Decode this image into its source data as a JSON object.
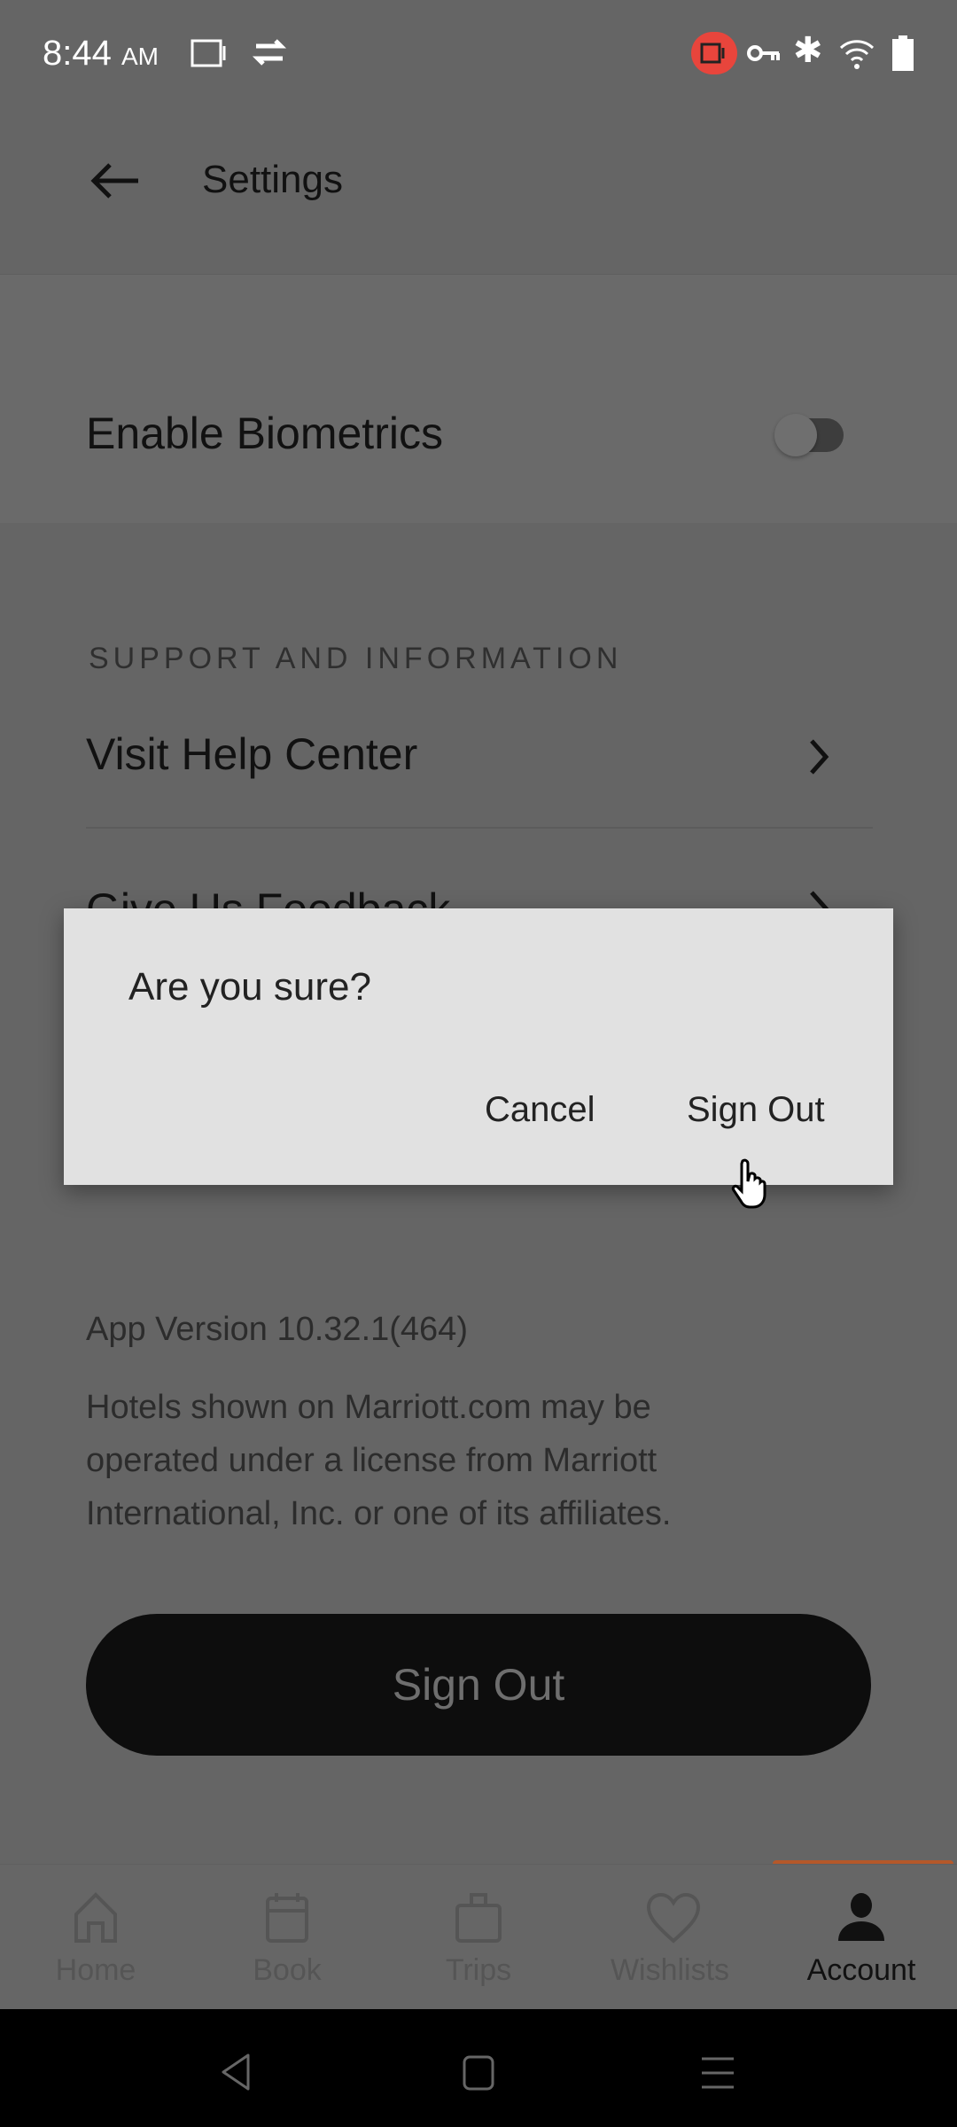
{
  "status_bar": {
    "time": "8:44",
    "ampm": "AM",
    "recording_color": "#e8453c"
  },
  "header": {
    "title": "Settings"
  },
  "biometrics": {
    "label": "Enable Biometrics",
    "enabled": false
  },
  "support": {
    "section_title": "SUPPORT AND INFORMATION",
    "items": [
      {
        "label": "Visit Help Center"
      },
      {
        "label": "Give Us Feedback"
      }
    ]
  },
  "dialog": {
    "title": "Are you sure?",
    "cancel": "Cancel",
    "confirm": "Sign Out"
  },
  "footer": {
    "app_version": "App Version 10.32.1(464)",
    "disclaimer_lines": [
      "Hotels shown on Marriott.com may be",
      "operated under a license from Marriott",
      "International, Inc. or one of its affiliates."
    ]
  },
  "sign_out_button": "Sign Out",
  "bottom_nav": {
    "active": "Account",
    "accent": "#b5582a",
    "items": [
      {
        "label": "Home",
        "icon": "home-icon"
      },
      {
        "label": "Book",
        "icon": "calendar-icon"
      },
      {
        "label": "Trips",
        "icon": "suitcase-icon"
      },
      {
        "label": "Wishlists",
        "icon": "heart-icon"
      },
      {
        "label": "Account",
        "icon": "person-icon"
      }
    ]
  }
}
